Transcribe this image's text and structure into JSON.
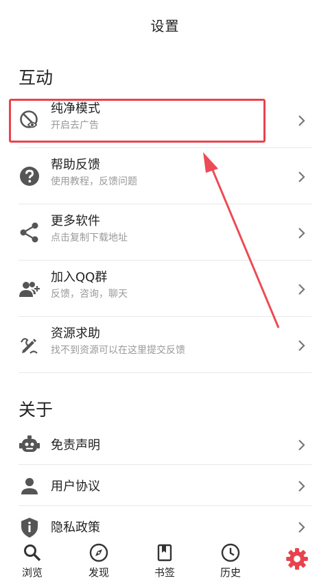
{
  "header": {
    "title": "设置"
  },
  "sections": [
    {
      "title": "互动",
      "items": [
        {
          "label": "纯净模式",
          "sublabel": "开启去广告",
          "icon": "eye-slash-icon"
        },
        {
          "label": "帮助反馈",
          "sublabel": "使用教程，反馈问题",
          "icon": "help-icon"
        },
        {
          "label": "更多软件",
          "sublabel": "点击复制下载地址",
          "icon": "share-icon"
        },
        {
          "label": "加入QQ群",
          "sublabel": "反馈，咨询，聊天",
          "icon": "group-add-icon"
        },
        {
          "label": "资源求助",
          "sublabel": "找不到资源可以在这里提交反馈",
          "icon": "draw-icon"
        }
      ]
    },
    {
      "title": "关于",
      "items": [
        {
          "label": "免责声明",
          "icon": "robot-icon"
        },
        {
          "label": "用户协议",
          "icon": "person-icon"
        },
        {
          "label": "隐私政策",
          "icon": "shield-icon"
        }
      ]
    }
  ],
  "bottom_nav": [
    {
      "label": "浏览",
      "icon": "search-icon"
    },
    {
      "label": "发现",
      "icon": "compass-icon"
    },
    {
      "label": "书签",
      "icon": "bookmark-icon"
    },
    {
      "label": "历史",
      "icon": "clock-icon"
    }
  ],
  "colors": {
    "accent": "#e8434c",
    "icon": "#555555",
    "sublabel": "#999999"
  }
}
